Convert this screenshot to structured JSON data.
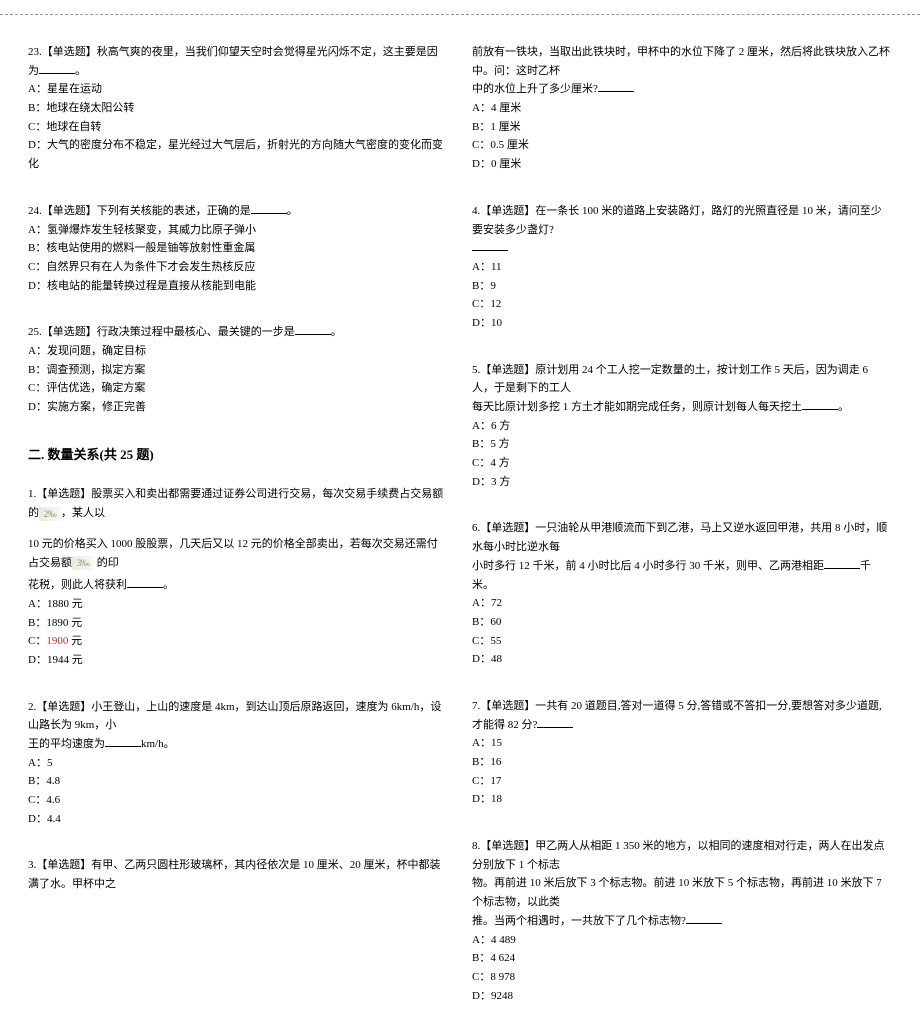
{
  "left": {
    "q23": {
      "stem": "23.【单选题】秋高气爽的夜里，当我们仰望天空时会觉得星光闪烁不定，这主要是因为",
      "optA": "A：星星在运动",
      "optB": "B：地球在绕太阳公转",
      "optC": "C：地球在自转",
      "optD": "D：大气的密度分布不稳定，星光经过大气层后，折射光的方向随大气密度的变化而变化"
    },
    "q24": {
      "stem": "24.【单选题】下列有关核能的表述，正确的是",
      "optA": "A：氢弹爆炸发生轻核聚变，其威力比原子弹小",
      "optB": "B：核电站使用的燃料一般是铀等放射性重金属",
      "optC": "C：自然界只有在人为条件下才会发生热核反应",
      "optD": "D：核电站的能量转换过程是直接从核能到电能"
    },
    "q25": {
      "stem": "25.【单选题】行政决策过程中最核心、最关键的一步是",
      "optA": "A：发现问题，确定目标",
      "optB": "B：调查预测，拟定方案",
      "optC": "C：评估优选，确定方案",
      "optD": "D：实施方案，修正完善"
    },
    "section2": "二. 数量关系(共 25 题)",
    "q1": {
      "line1a": "1.【单选题】股票买入和卖出都需要通过证券公司进行交易，每次交易手续费占交易额的",
      "frac1": "2‰",
      "line1b": "，某人以",
      "line2a": "10 元的价格买入 1000 股股票，几天后又以 12 元的价格全部卖出，若每次交易还需付占交易额",
      "frac2": "3‰",
      "line2b": " 的印",
      "line3": "花税，则此人将获利",
      "optA": "A：1880 元",
      "optB": "B：1890 元",
      "optC_pre": "C：",
      "optC_val": "1900",
      "optC_suf": " 元",
      "optD": "D：1944 元"
    },
    "q2": {
      "stem1": "2.【单选题】小王登山，上山的速度是 4km，到达山顶后原路返回，速度为 6km/h，设山路长为 9km，小",
      "stem2": "王的平均速度为",
      "stem2_suf": "km/h。",
      "optA": "A：5",
      "optB": "B：4.8",
      "optC": "C：4.6",
      "optD": "D：4.4"
    },
    "q3": {
      "stem": "3.【单选题】有甲、乙两只圆柱形玻璃杯，其内径依次是 10 厘米、20 厘米，杯中都装满了水。甲杯中之"
    }
  },
  "right": {
    "q3cont": {
      "line1": "前放有一铁块，当取出此铁块时，甲杯中的水位下降了 2 厘米，然后将此铁块放入乙杯中。问：这时乙杯",
      "line2": "中的水位上升了多少厘米?",
      "optA": "A：4 厘米",
      "optB": "B：1 厘米",
      "optC": "C：0.5 厘米",
      "optD": "D：0 厘米"
    },
    "q4": {
      "stem": "4.【单选题】在一条长 100 米的道路上安装路灯，路灯的光照直径是 10 米，请问至少要安装多少盏灯?",
      "optA": "A：11",
      "optB": "B：9",
      "optC": "C：12",
      "optD": "D：10"
    },
    "q5": {
      "stem1": "5.【单选题】原计划用 24 个工人挖一定数量的土，按计划工作 5 天后，因为调走 6 人，于是剩下的工人",
      "stem2": "每天比原计划多挖 1 方土才能如期完成任务，则原计划每人每天挖土",
      "optA": "A：6 方",
      "optB": "B：5 方",
      "optC": "C：4 方",
      "optD": "D：3 方"
    },
    "q6": {
      "stem1": "6.【单选题】一只油轮从甲港顺流而下到乙港，马上又逆水返回甲港，共用 8 小时，顺水每小时比逆水每",
      "stem2": "小时多行 12 千米，前 4 小时比后 4 小时多行 30 千米，则甲、乙两港相距",
      "stem2_suf": "千米。",
      "optA": "A：72",
      "optB": "B：60",
      "optC": "C：55",
      "optD": "D：48"
    },
    "q7": {
      "stem": "7.【单选题】一共有 20 道题目,答对一道得 5 分,答错或不答扣一分,要想答对多少道题,才能得 82 分?",
      "optA": "A：15",
      "optB": "B：16",
      "optC": "C：17",
      "optD": "D：18"
    },
    "q8": {
      "stem1": "8.【单选题】甲乙两人从相距 1 350 米的地方，以相同的速度相对行走，两人在出发点分别放下 1 个标志",
      "stem2": "物。再前进 10 米后放下 3 个标志物。前进 10 米放下 5 个标志物，再前进 10 米放下 7 个标志物，以此类",
      "stem3": "推。当两个相遇时，一共放下了几个标志物?",
      "optA": "A：4 489",
      "optB": "B：4 624",
      "optC": "C：8 978",
      "optD": "D：9248"
    }
  }
}
